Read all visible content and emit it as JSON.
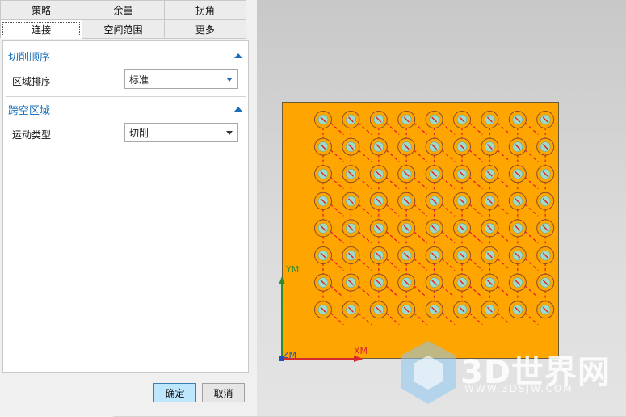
{
  "tabs_row1": [
    "策略",
    "余量",
    "拐角"
  ],
  "tabs_row2": [
    "连接",
    "空间范围",
    "更多"
  ],
  "active_tab": "连接",
  "sections": {
    "cut_order": {
      "title": "切削顺序",
      "field_label": "区域排序",
      "field_value": "标准"
    },
    "transfer": {
      "title": "跨空区域",
      "field_label": "运动类型",
      "field_value": "切削"
    }
  },
  "buttons": {
    "ok": "确定",
    "cancel": "取消"
  },
  "viewport": {
    "axis_y": "YM",
    "axis_x": "XM",
    "axis_z": "ZM",
    "part_color": "#ffa500",
    "toolpath_color": "#e8202a",
    "hole_grid": {
      "columns": 9,
      "rows": 8
    }
  },
  "watermark": {
    "title": "3D世界网",
    "url": "WWW.3DSJW.COM"
  }
}
